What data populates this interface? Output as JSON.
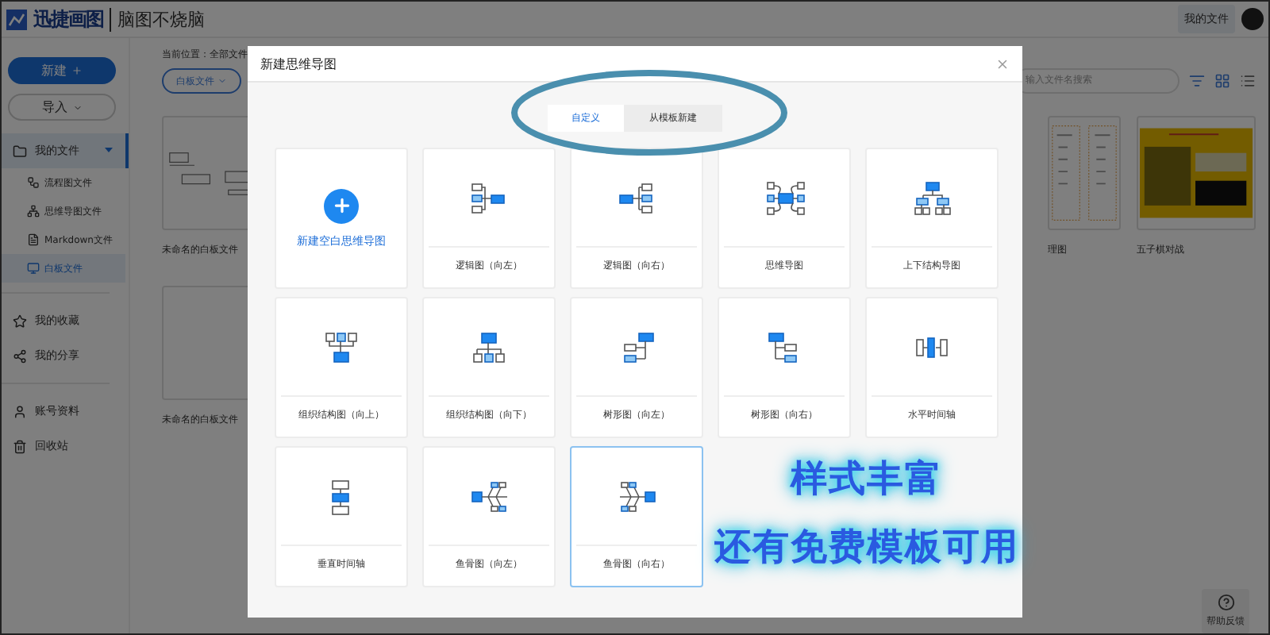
{
  "header": {
    "logo": "迅捷画图",
    "slogan": "脑图不烧脑",
    "my_files_button": "我的文件"
  },
  "sidebar": {
    "new_button": "新建",
    "import_button": "导入",
    "items": [
      {
        "label": "我的文件",
        "selected": false,
        "expanded": true,
        "children": [
          {
            "label": "流程图文件",
            "selected": false
          },
          {
            "label": "思维导图文件",
            "selected": false
          },
          {
            "label": "Markdown文件",
            "selected": false
          },
          {
            "label": "白板文件",
            "selected": true
          }
        ]
      },
      {
        "label": "我的收藏",
        "selected": false
      },
      {
        "label": "我的分享",
        "selected": false
      },
      {
        "label": "账号资料",
        "selected": false
      },
      {
        "label": "回收站",
        "selected": false
      }
    ]
  },
  "main": {
    "breadcrumb": "当前位置：全部文件",
    "filter": "白板文件",
    "search": {
      "placeholder": "输入文件名搜索"
    },
    "file_rows": [
      [
        {
          "title": "未命名的白板文件",
          "kind": "sketch",
          "cut": false
        },
        {
          "title": "理图",
          "kind": "table",
          "cut": true
        },
        {
          "title": "五子棋对战",
          "kind": "board",
          "cut": false
        }
      ],
      [
        {
          "title": "未命名的白板文件",
          "kind": "blank",
          "cut": false
        }
      ]
    ],
    "help_button": "帮助反馈"
  },
  "dialog": {
    "title": "新建思维导图",
    "tabs": [
      {
        "label": "自定义",
        "selected": true
      },
      {
        "label": "从模板新建",
        "selected": false
      }
    ],
    "cards": [
      {
        "kind": "blank",
        "label": "新建空白思维导图",
        "selected": false
      },
      {
        "kind": "logic-left",
        "label": "逻辑图（向左）",
        "selected": false
      },
      {
        "kind": "logic-right",
        "label": "逻辑图（向右）",
        "selected": false
      },
      {
        "kind": "mindmap",
        "label": "思维导图",
        "selected": false
      },
      {
        "kind": "org",
        "label": "上下结构导图",
        "selected": false
      },
      {
        "kind": "org-up",
        "label": "组织结构图（向上）",
        "selected": false
      },
      {
        "kind": "org-down",
        "label": "组织结构图（向下）",
        "selected": false
      },
      {
        "kind": "tree-left",
        "label": "树形图（向左）",
        "selected": false
      },
      {
        "kind": "tree-right",
        "label": "树形图（向右）",
        "selected": false
      },
      {
        "kind": "timeline-h",
        "label": "水平时间轴",
        "selected": false
      },
      {
        "kind": "timeline-v",
        "label": "垂直时间轴",
        "selected": false
      },
      {
        "kind": "fish-left",
        "label": "鱼骨图（向左）",
        "selected": false
      },
      {
        "kind": "fish-right",
        "label": "鱼骨图（向右）",
        "selected": true
      }
    ]
  },
  "promo": [
    "样式丰富",
    "还有免费模板可用"
  ]
}
